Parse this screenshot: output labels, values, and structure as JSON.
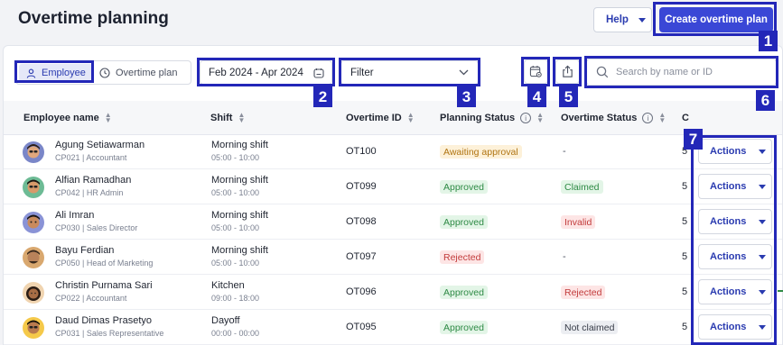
{
  "page": {
    "title": "Overtime planning"
  },
  "header": {
    "help_label": "Help",
    "create_label": "Create overtime plan"
  },
  "toolbar": {
    "view_employee": "Employee",
    "view_overtime": "Overtime plan",
    "date_range": "Feb 2024 - Apr 2024",
    "filter_label": "Filter",
    "search_placeholder": "Search by name or ID"
  },
  "annotations": [
    "1",
    "2",
    "3",
    "4",
    "5",
    "6",
    "7"
  ],
  "table": {
    "columns": [
      "Employee name",
      "Shift",
      "Overtime ID",
      "Planning Status",
      "Overtime Status",
      "C"
    ],
    "rows": [
      {
        "name": "Agung Setiawarman",
        "id": "CP021",
        "role": "Accountant",
        "shift": "Morning shift",
        "time": "05:00 - 10:00",
        "ot_id": "OT100",
        "planning": "Awaiting approval",
        "overtime": "-",
        "c": "5",
        "actions": "Actions"
      },
      {
        "name": "Alfian Ramadhan",
        "id": "CP042",
        "role": "HR Admin",
        "shift": "Morning shift",
        "time": "05:00 - 10:00",
        "ot_id": "OT099",
        "planning": "Approved",
        "overtime": "Claimed",
        "c": "5",
        "actions": "Actions"
      },
      {
        "name": "Ali Imran",
        "id": "CP030",
        "role": "Sales Director",
        "shift": "Morning shift",
        "time": "05:00 - 10:00",
        "ot_id": "OT098",
        "planning": "Approved",
        "overtime": "Invalid",
        "c": "5",
        "actions": "Actions"
      },
      {
        "name": "Bayu Ferdian",
        "id": "CP050",
        "role": "Head of Marketing",
        "shift": "Morning shift",
        "time": "05:00 - 10:00",
        "ot_id": "OT097",
        "planning": "Rejected",
        "overtime": "-",
        "c": "5",
        "actions": "Actions"
      },
      {
        "name": "Christin Purnama Sari",
        "id": "CP022",
        "role": "Accountant",
        "shift": "Kitchen",
        "time": "09:00 - 18:00",
        "ot_id": "OT096",
        "planning": "Approved",
        "overtime": "Rejected",
        "c": "5",
        "actions": "Actions"
      },
      {
        "name": "Daud Dimas Prasetyo",
        "id": "CP031",
        "role": "Sales Representative",
        "shift": "Dayoff",
        "time": "00:00 - 00:00",
        "ot_id": "OT095",
        "planning": "Approved",
        "overtime": "Not claimed",
        "c": "5",
        "actions": "Actions"
      }
    ]
  },
  "colors": {
    "accent": "#3a47d6",
    "annotation": "#2327b8"
  }
}
